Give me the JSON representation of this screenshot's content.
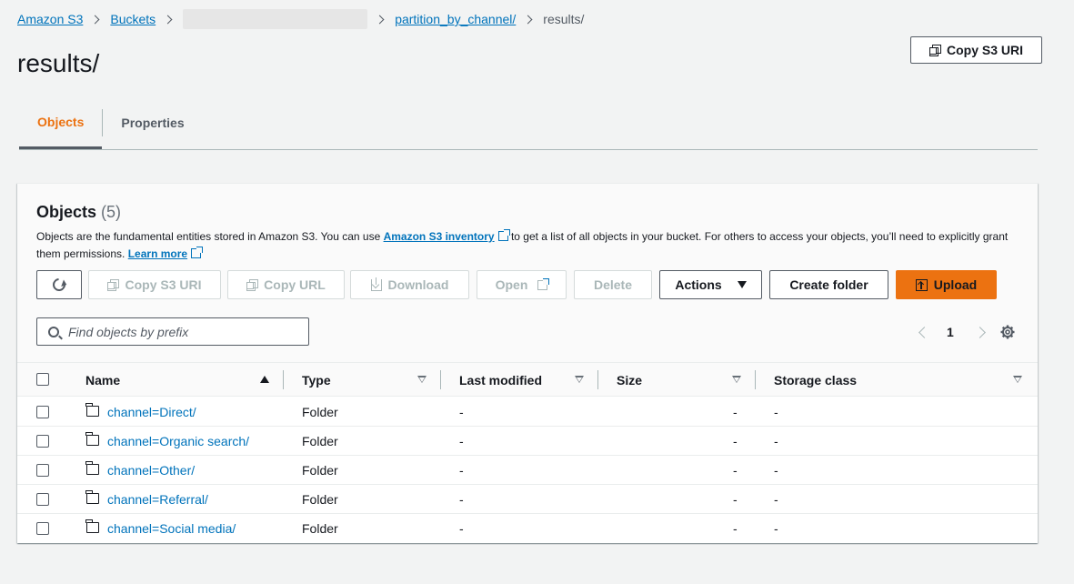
{
  "breadcrumb": {
    "items": [
      "Amazon S3",
      "Buckets",
      "partition_by_channel/",
      "results/"
    ]
  },
  "page": {
    "title": "results/",
    "copy_uri_label": "Copy S3 URI"
  },
  "tabs": [
    "Objects",
    "Properties"
  ],
  "objects": {
    "title": "Objects",
    "count": "(5)",
    "desc_prefix": "Objects are the fundamental entities stored in Amazon S3. You can use ",
    "desc_link": "Amazon S3 inventory",
    "desc_suffix": " to get a list of all objects in your bucket. For others to access your objects, you’ll need to explicitly grant them permissions.",
    "learn_more": "Learn more"
  },
  "toolbar": {
    "copy_s3_uri": "Copy S3 URI",
    "copy_url": "Copy URL",
    "download": "Download",
    "open": "Open",
    "delete": "Delete",
    "actions": "Actions",
    "create_folder": "Create folder",
    "upload": "Upload"
  },
  "search": {
    "placeholder": "Find objects by prefix"
  },
  "pagination": {
    "page": "1"
  },
  "table": {
    "columns": [
      "Name",
      "Type",
      "Last modified",
      "Size",
      "Storage class"
    ],
    "rows": [
      {
        "name": "channel=Direct/",
        "type": "Folder",
        "modified": "-",
        "size": "-",
        "storage": "-"
      },
      {
        "name": "channel=Organic search/",
        "type": "Folder",
        "modified": "-",
        "size": "-",
        "storage": "-"
      },
      {
        "name": "channel=Other/",
        "type": "Folder",
        "modified": "-",
        "size": "-",
        "storage": "-"
      },
      {
        "name": "channel=Referral/",
        "type": "Folder",
        "modified": "-",
        "size": "-",
        "storage": "-"
      },
      {
        "name": "channel=Social media/",
        "type": "Folder",
        "modified": "-",
        "size": "-",
        "storage": "-"
      }
    ]
  },
  "colors": {
    "accent": "#ec7211",
    "link": "#0073bb",
    "text": "#16191f"
  }
}
